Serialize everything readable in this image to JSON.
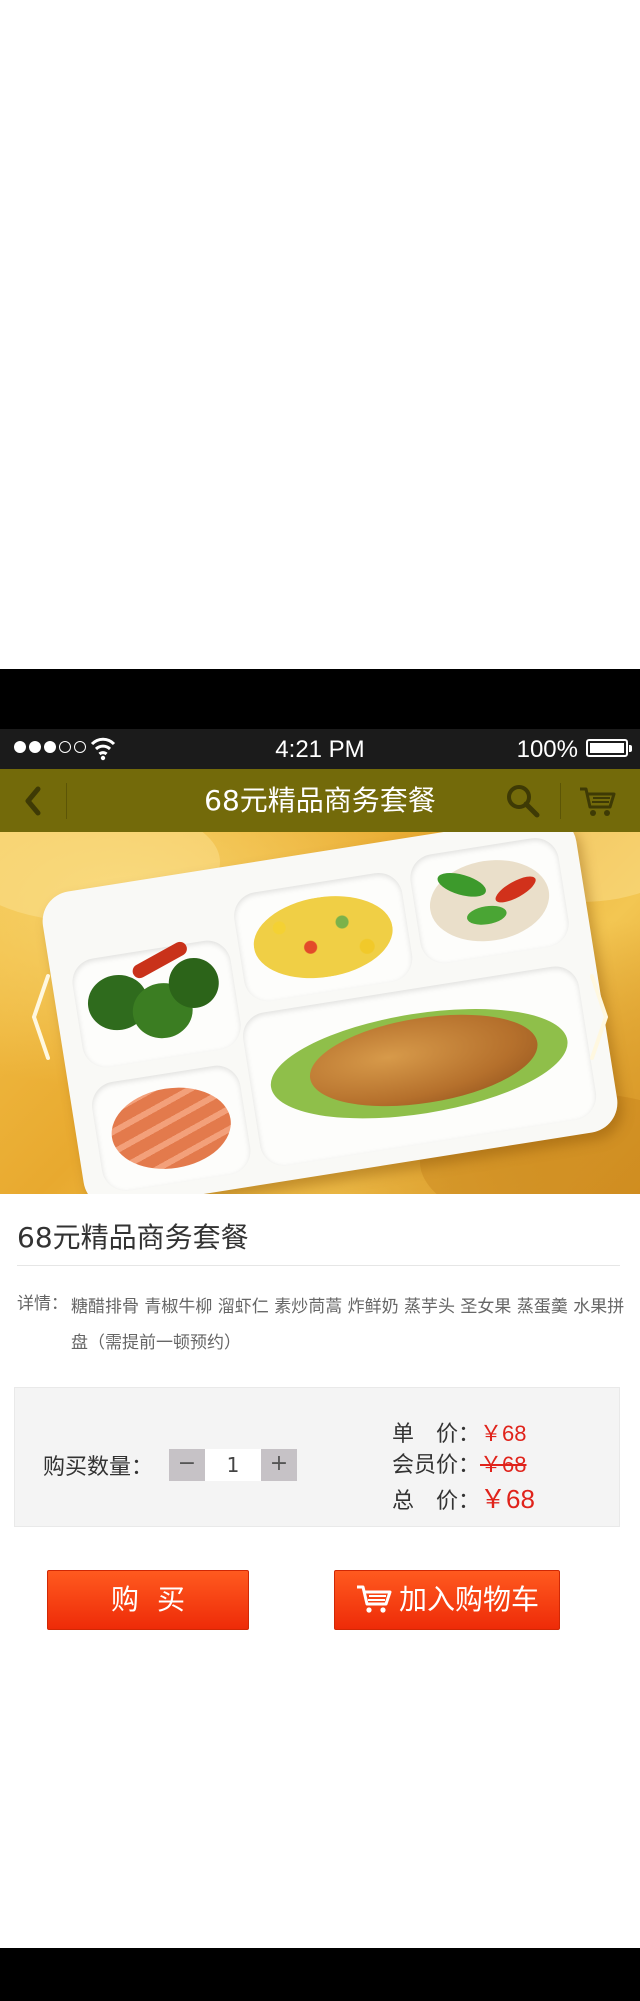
{
  "status_bar": {
    "time": "4:21 PM",
    "battery": "100%",
    "signal_filled": 3,
    "signal_total": 5
  },
  "nav": {
    "title": "68元精品商务套餐",
    "back_icon": "chevron-left-icon",
    "search_icon": "search-icon",
    "cart_icon": "cart-icon",
    "bar_color": "#736a0a"
  },
  "banner": {
    "prev_icon": "chevron-left-icon",
    "next_icon": "chevron-right-icon"
  },
  "product": {
    "title": "68元精品商务套餐",
    "detail_label": "详情：",
    "detail_text": "糖醋排骨  青椒牛柳  溜虾仁  素炒茼蒿  炸鲜奶  蒸芋头  圣女果  蒸蛋羹  水果拼盘（需提前一顿预约）"
  },
  "purchase": {
    "qty_label": "购买数量：",
    "minus": "−",
    "quantity": "1",
    "plus": "+",
    "unit_price_label": "单　价：",
    "unit_price": "￥68",
    "member_price_label": "会员价：",
    "member_price": "￥68",
    "total_label": "总　价：",
    "total_price": "￥68",
    "price_color": "#e0231b"
  },
  "buttons": {
    "buy": "购买",
    "add_to_cart": "加入购物车",
    "color": "#f3360c"
  }
}
